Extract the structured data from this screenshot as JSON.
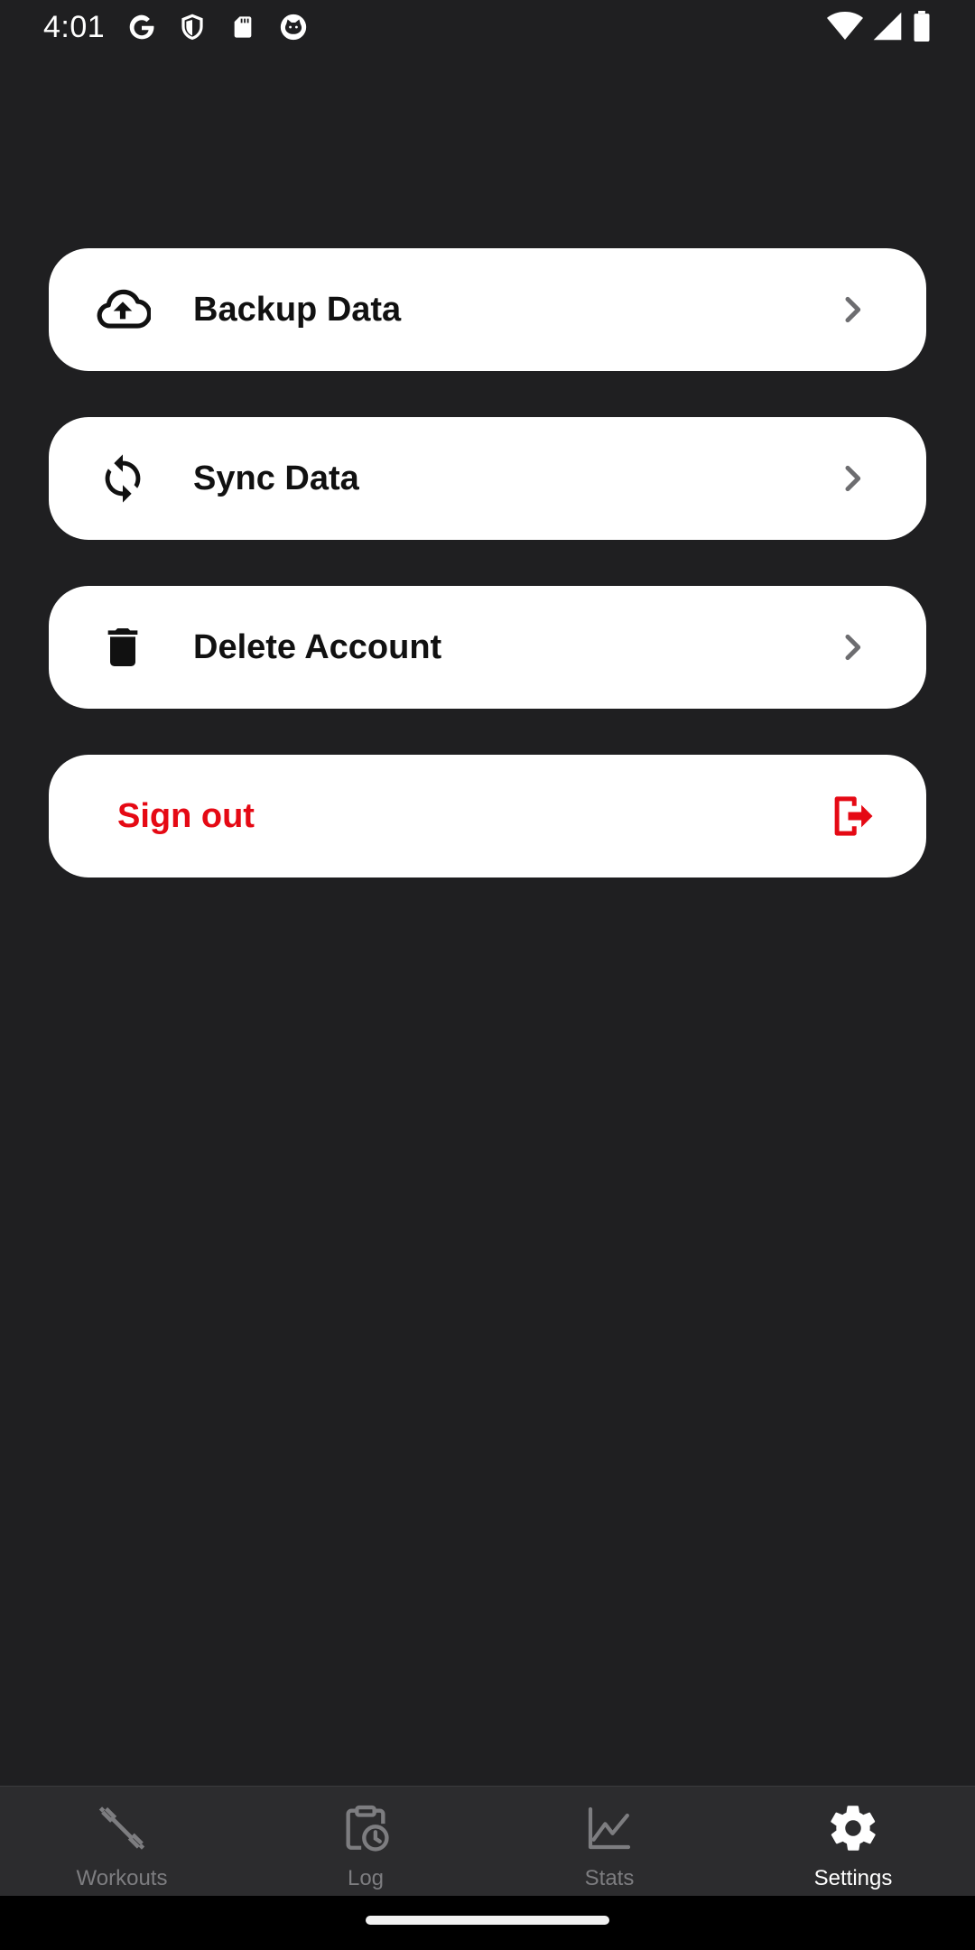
{
  "status_bar": {
    "time": "4:01"
  },
  "settings": {
    "items": [
      {
        "label": "Backup Data",
        "icon": "cloud-upload-icon"
      },
      {
        "label": "Sync Data",
        "icon": "sync-icon"
      },
      {
        "label": "Delete Account",
        "icon": "trash-icon"
      }
    ],
    "sign_out": {
      "label": "Sign out",
      "icon": "logout-icon",
      "color": "#e50914"
    }
  },
  "bottom_nav": {
    "items": [
      {
        "label": "Workouts",
        "icon": "dumbbell-icon",
        "active": false
      },
      {
        "label": "Log",
        "icon": "clipboard-clock-icon",
        "active": false
      },
      {
        "label": "Stats",
        "icon": "line-chart-icon",
        "active": false
      },
      {
        "label": "Settings",
        "icon": "gear-icon",
        "active": true
      }
    ]
  },
  "colors": {
    "background": "#1f1f21",
    "card": "#ffffff",
    "accent_red": "#e50914",
    "nav_bg": "#2c2c2e",
    "nav_inactive": "#7d7d80",
    "nav_active": "#ffffff"
  }
}
